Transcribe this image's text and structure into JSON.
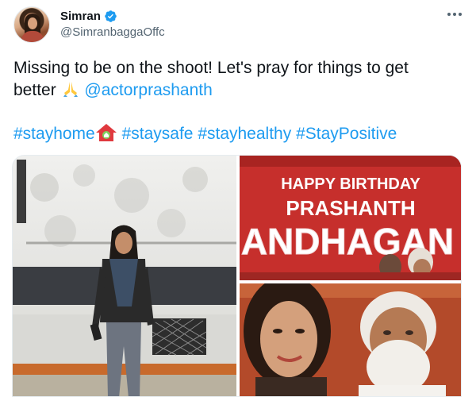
{
  "user": {
    "display_name": "Simran",
    "handle": "@SimranbaggaOffc",
    "verified_icon": "verified-badge-icon"
  },
  "more_icon": "more-horizontal-icon",
  "tweet": {
    "text_line1": "Missing to be on the shoot! Let's pray for things to get",
    "text_line2_prefix": "better",
    "mention": "@actorprashanth",
    "hashtags": [
      "#stayhome",
      "#staysafe",
      "#stayhealthy",
      "#StayPositive"
    ]
  },
  "banner": {
    "line1": "HAPPY BIRTHDAY",
    "line2": "PRASHANTH",
    "line3": "ANDHAGAN"
  },
  "colors": {
    "link": "#1d9bf0",
    "verified": "#1d9bf0",
    "banner_red": "#c9302e"
  }
}
